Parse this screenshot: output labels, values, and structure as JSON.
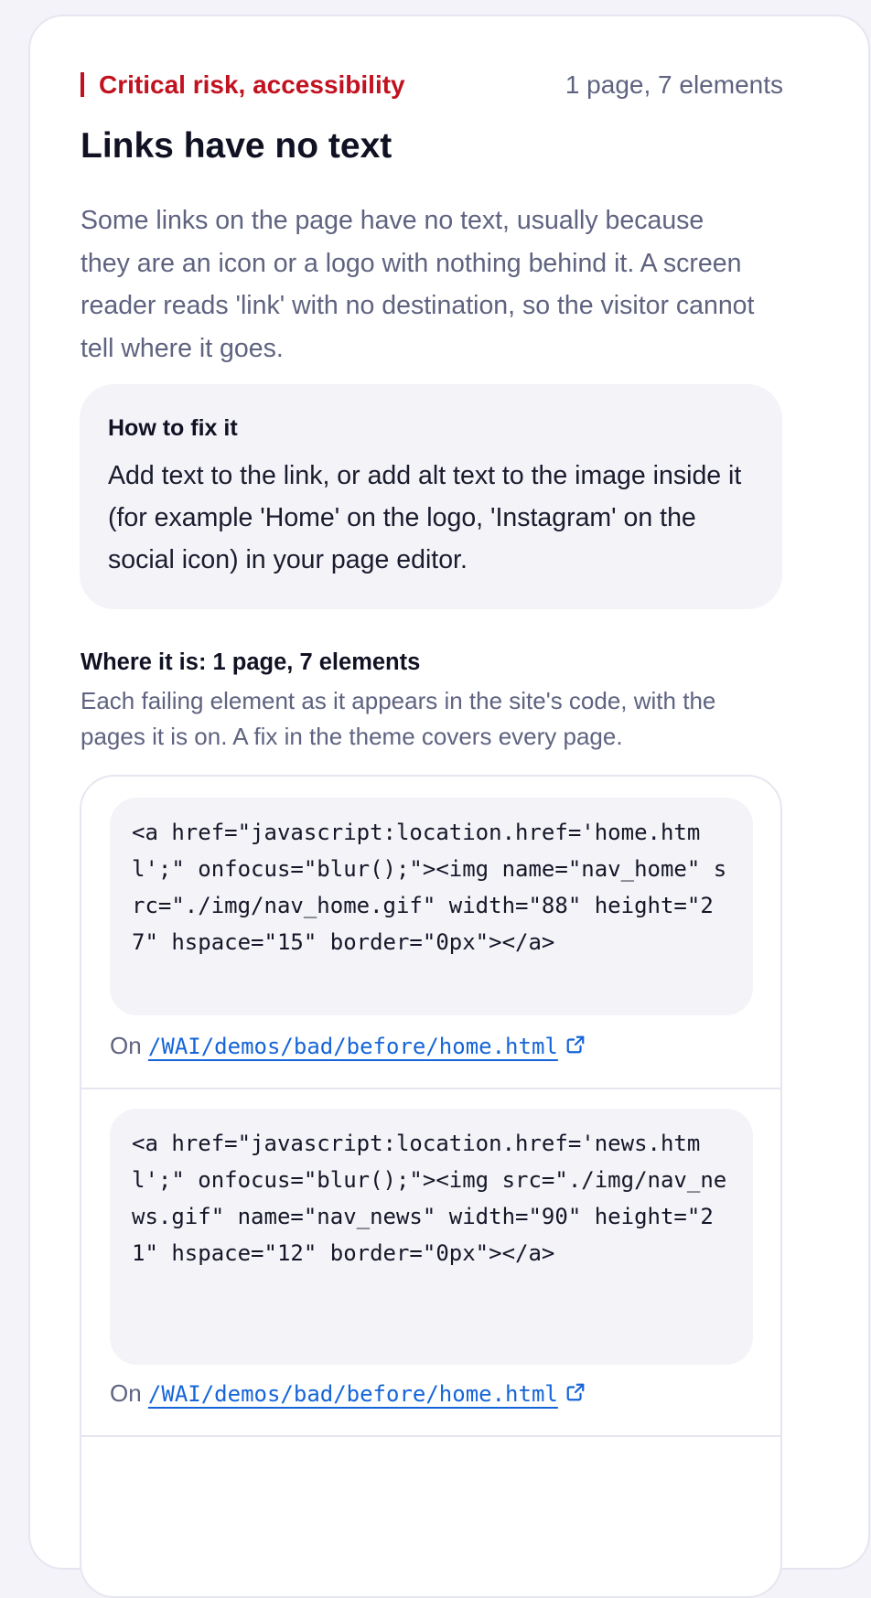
{
  "issue": {
    "risk_label": "Critical risk, accessibility",
    "risk_color": "#c1121f",
    "count_summary": "1 page, 7 elements",
    "title": "Links have no text",
    "description": "Some links on the page have no text, usually because they are an icon or a logo with nothing behind it. A screen reader reads 'link' with no destination, so the visitor cannot tell where it goes."
  },
  "fix": {
    "title": "How to fix it",
    "text": "Add text to the link, or add alt text to the image inside it (for example 'Home' on the logo, 'Instagram' on the social icon) in your page editor."
  },
  "where": {
    "title": "Where it is: 1 page, 7 elements",
    "description": "Each failing element as it appears in the site's code, with the pages it is on. A fix in the theme covers every page.",
    "occurrences": [
      {
        "code": "<a href=\"javascript:location.href='home.html';\" onfocus=\"blur();\"><img name=\"nav_home\" src=\"./img/nav_home.gif\" width=\"88\" height=\"27\" hspace=\"15\" border=\"0px\"></a>",
        "on_prefix": "On",
        "page": "/WAI/demos/bad/before/home.html",
        "link_icon": "external-link-icon"
      },
      {
        "code": "<a href=\"javascript:location.href='news.html';\" onfocus=\"blur();\"><img src=\"./img/nav_news.gif\" name=\"nav_news\" width=\"90\" height=\"21\" hspace=\"12\" border=\"0px\"></a>",
        "on_prefix": "On",
        "page": "/WAI/demos/bad/before/home.html",
        "link_icon": "external-link-icon"
      }
    ]
  },
  "colors": {
    "link": "#1565d8",
    "muted_text": "#5f6380",
    "heading_text": "#101223",
    "panel_bg": "#f3f3f8"
  }
}
